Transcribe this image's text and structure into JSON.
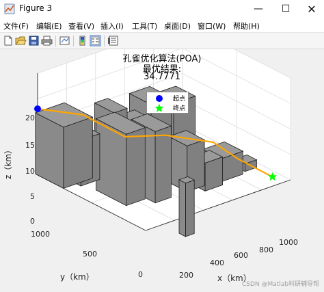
{
  "window": {
    "title": "Figure 3",
    "buttons": {
      "minimize": "—",
      "maximize": "☐",
      "close": "✕"
    }
  },
  "menu": [
    "文件(F)",
    "编辑(E)",
    "查看(V)",
    "插入(I)",
    "工具(T)",
    "桌面(D)",
    "窗口(W)",
    "帮助(H)"
  ],
  "toolbar": {
    "icons": [
      "new-figure-icon",
      "open-file-icon",
      "save-icon",
      "print-icon",
      "link-plot-icon",
      "insert-colorbar-icon",
      "insert-legend-icon",
      "property-inspector-icon"
    ]
  },
  "chart_data": {
    "type": "3d-path",
    "title_lines": [
      "孔雀优化算法(POA)",
      "最优结果:",
      "34.7771"
    ],
    "xlabel": "x（km）",
    "ylabel": "y（km）",
    "zlabel": "z（km）",
    "xlim": [
      0,
      1000
    ],
    "ylim": [
      0,
      1000
    ],
    "zlim": [
      0,
      20
    ],
    "xticks": [
      "200",
      "400",
      "600",
      "800",
      "1000"
    ],
    "yticks": [
      "0",
      "500",
      "1000"
    ],
    "zticks": [
      "0",
      "5",
      "10",
      "15",
      "20"
    ],
    "grid": true,
    "legend": {
      "placement": "top-center",
      "entries": [
        {
          "label": "起点",
          "marker": "circle",
          "color": "#0000ff"
        },
        {
          "label": "终点",
          "marker": "pentagram",
          "color": "#00ff00"
        }
      ]
    },
    "obstacle_color": "#808080",
    "path_color": "#ffa500",
    "start": {
      "x": 0,
      "y": 1000,
      "z": 13
    },
    "goal": {
      "x": 950,
      "y": 100,
      "z": 0
    },
    "path": [
      {
        "x": 0,
        "y": 1000,
        "z": 13
      },
      {
        "x": 180,
        "y": 820,
        "z": 12
      },
      {
        "x": 380,
        "y": 700,
        "z": 7
      },
      {
        "x": 600,
        "y": 620,
        "z": 6
      },
      {
        "x": 780,
        "y": 420,
        "z": 5
      },
      {
        "x": 830,
        "y": 260,
        "z": 3
      },
      {
        "x": 950,
        "y": 100,
        "z": 0
      }
    ]
  },
  "watermark": "CSDN @Matlab科研辅导帮"
}
